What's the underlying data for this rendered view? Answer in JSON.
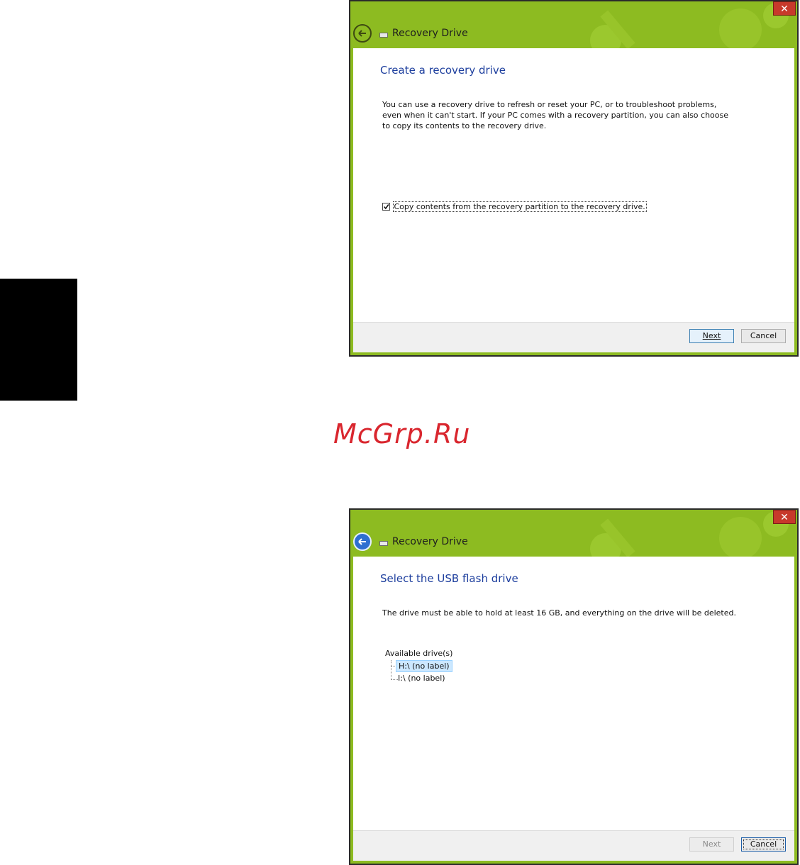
{
  "watermark": "McGrp.Ru",
  "window1": {
    "close_glyph": "✕",
    "title": "Recovery Drive",
    "heading": "Create a recovery drive",
    "description": "You can use a recovery drive to refresh or reset your PC, or to troubleshoot problems, even when it can't start. If your PC comes with a recovery partition, you can also choose to copy its contents to the recovery drive.",
    "checkbox_label": "Copy contents from the recovery partition to the recovery drive.",
    "checkbox_checked": true,
    "next_label": "Next",
    "cancel_label": "Cancel"
  },
  "window2": {
    "close_glyph": "✕",
    "title": "Recovery Drive",
    "heading": "Select the USB flash drive",
    "description": "The drive must be able to hold at least 16 GB, and everything on the drive will be deleted.",
    "tree_label": "Available drive(s)",
    "drives": [
      "H:\\ (no label)",
      "I:\\ (no label)"
    ],
    "selected_drive": "H:\\ (no label)",
    "next_label": "Next",
    "cancel_label": "Cancel"
  },
  "colors": {
    "titlebar": "#8dbb21",
    "heading": "#1e3f9e",
    "close": "#c7392b",
    "watermark": "#d9262e"
  },
  "icons": [
    "back-arrow-icon",
    "drive-icon",
    "close-icon",
    "checkmark-icon"
  ]
}
